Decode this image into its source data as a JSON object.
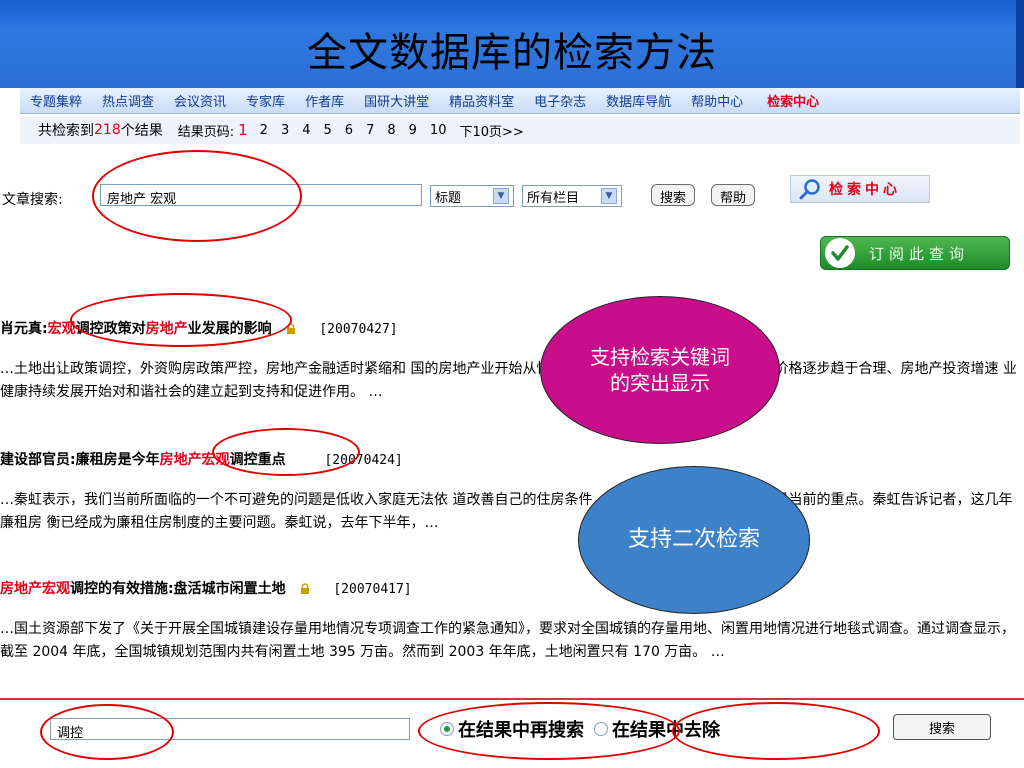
{
  "slide": {
    "title": "全文数据库的检索方法"
  },
  "nav": {
    "items": [
      "专题集粹",
      "热点调查",
      "会议资讯",
      "专家库",
      "作者库",
      "国研大讲堂",
      "精品资料室",
      "电子杂志",
      "数据库导航",
      "帮助中心"
    ],
    "active": "检索中心"
  },
  "results": {
    "prefix": "共检索到",
    "count": "218",
    "suffix": "个结果",
    "page_label": "结果页码:",
    "current_page": "1",
    "pages": [
      "2",
      "3",
      "4",
      "5",
      "6",
      "7",
      "8",
      "9",
      "10",
      "下10页>>"
    ]
  },
  "search": {
    "label": "文章搜索:",
    "value": "房地产 宏观",
    "field_select": "标题",
    "column_select": "所有栏目",
    "search_button": "搜索",
    "help_button": "帮助",
    "center_logo": "检索中心",
    "subscribe": "订阅此查询"
  },
  "articles": [
    {
      "title_prefix": "肖元真:",
      "title_hl1": "宏观",
      "title_mid": "调控政策对",
      "title_hl2": "房地产",
      "title_suffix": "业发展的影响",
      "date": "[20070427]",
      "body": "…土地出让政策调控，外资购房政策严控，房地产金融适时紧缩和                                                                                    国的房地产业开始从快速增长期进入理性发展期，在房地产价格逐步趋于合理、房地产投资增速                                                                                    业健康持续发展开始对和谐社会的建立起到支持和促进作用。 …"
    },
    {
      "title_prefix": "建设部官员:廉租房是今年",
      "title_hl1": "房地产宏观",
      "title_mid": "",
      "title_hl2": "",
      "title_suffix": "调控重点",
      "date": "[20070424]",
      "body": "…秦虹表示，我们当前所面临的一个不可避免的问题是低收入家庭无法依                                                                                    道改善自己的住房条件，所以低收入家庭的住房问题是当前的重点。秦虹告诉记者，这几年廉租房                                                                                    衡已经成为廉租住房制度的主要问题。秦虹说，去年下半年，…"
    },
    {
      "title_prefix": "",
      "title_hl1": "房地产宏观",
      "title_mid": "",
      "title_hl2": "",
      "title_suffix": "调控的有效措施:盘活城市闲置土地",
      "date": "[20070417]",
      "body": "…国土资源部下发了《关于开展全国城镇建设存量用地情况专项调查工作的紧急通知》，要求对全国城镇的存量用地、闲置用地情况进行地毯式调查。通过调查显示，截至 2004 年底，全国城镇规划范围内共有闲置土地 395 万亩。然而到 2003 年年底，土地闲置只有 170 万亩。 …"
    }
  ],
  "bottom": {
    "input_value": "调控",
    "radio1": "在结果中再搜索",
    "radio2": "在结果中去除",
    "button": "搜索"
  },
  "callouts": {
    "highlight": "支持检索关键词的突出显示",
    "secondary": "支持二次检索"
  },
  "colors": {
    "title_band": "#2b6fd6",
    "highlight": "#e2001a",
    "callout1": "#c90e8b",
    "callout2": "#3d82c9",
    "annotation": "#e10000"
  }
}
